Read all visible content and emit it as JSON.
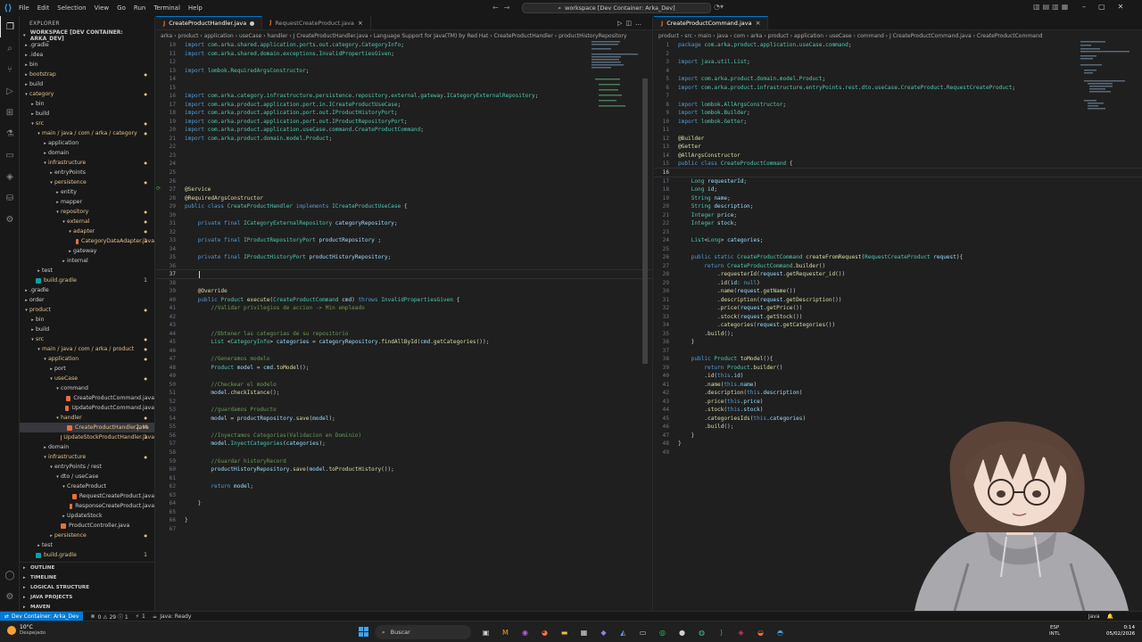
{
  "window": {
    "menu": [
      "File",
      "Edit",
      "Selection",
      "View",
      "Go",
      "Run",
      "Terminal",
      "Help"
    ],
    "search_text": "workspace [Dev Container: Arka_Dev]"
  },
  "activity_icons": [
    "explorer-icon",
    "search-icon",
    "source-control-icon",
    "run-debug-icon",
    "extensions-icon",
    "testing-icon",
    "remote-explorer-icon",
    "docker-icon",
    "database-icon",
    "gear-icon"
  ],
  "sidebar": {
    "title": "EXPLORER",
    "workspace": "WORKSPACE [DEV CONTAINER: ARKA_DEV]",
    "tree": [
      {
        "label": ".gradle",
        "depth": 0,
        "kind": "folder",
        "open": false,
        "color": "#cccccc"
      },
      {
        "label": ".idea",
        "depth": 0,
        "kind": "folder",
        "open": false,
        "color": "#cccccc"
      },
      {
        "label": "bin",
        "depth": 0,
        "kind": "folder",
        "open": false,
        "color": "#cccccc"
      },
      {
        "label": "bootstrap",
        "depth": 0,
        "kind": "folder",
        "open": false,
        "color": "#e2c08d",
        "dot": "#e2c08d"
      },
      {
        "label": "build",
        "depth": 0,
        "kind": "folder",
        "open": false,
        "color": "#cccccc"
      },
      {
        "label": "category",
        "depth": 0,
        "kind": "folder",
        "open": true,
        "color": "#e2c08d",
        "dot": "#e2c08d"
      },
      {
        "label": "bin",
        "depth": 1,
        "kind": "folder",
        "open": false,
        "color": "#cccccc"
      },
      {
        "label": "build",
        "depth": 1,
        "kind": "folder",
        "open": false,
        "color": "#cccccc"
      },
      {
        "label": "src",
        "depth": 1,
        "kind": "folder",
        "open": true,
        "color": "#e2c08d",
        "dot": "#e2c08d"
      },
      {
        "label": "main / java / com / arka / category",
        "depth": 2,
        "kind": "folder",
        "open": true,
        "color": "#e2c08d",
        "dot": "#e2c08d"
      },
      {
        "label": "application",
        "depth": 3,
        "kind": "folder",
        "open": false,
        "color": "#cccccc"
      },
      {
        "label": "domain",
        "depth": 3,
        "kind": "folder",
        "open": false,
        "color": "#cccccc"
      },
      {
        "label": "infrastructure",
        "depth": 3,
        "kind": "folder",
        "open": true,
        "color": "#e2c08d",
        "dot": "#e2c08d"
      },
      {
        "label": "entryPoints",
        "depth": 4,
        "kind": "folder",
        "open": false,
        "color": "#cccccc"
      },
      {
        "label": "persistence",
        "depth": 4,
        "kind": "folder",
        "open": true,
        "color": "#e2c08d",
        "dot": "#e2c08d"
      },
      {
        "label": "entity",
        "depth": 5,
        "kind": "folder",
        "open": false,
        "color": "#cccccc"
      },
      {
        "label": "mapper",
        "depth": 5,
        "kind": "folder",
        "open": false,
        "color": "#cccccc"
      },
      {
        "label": "repository",
        "depth": 5,
        "kind": "folder",
        "open": true,
        "color": "#e2c08d",
        "dot": "#e2c08d"
      },
      {
        "label": "external",
        "depth": 6,
        "kind": "folder",
        "open": true,
        "color": "#e2c08d",
        "dot": "#e2c08d"
      },
      {
        "label": "adapter",
        "depth": 7,
        "kind": "folder",
        "open": true,
        "color": "#e2c08d",
        "dot": "#e2c08d"
      },
      {
        "label": "CategoryDataAdapter.java",
        "depth": 8,
        "kind": "java",
        "color": "#e2c08d",
        "badge": "1"
      },
      {
        "label": "gateway",
        "depth": 7,
        "kind": "folder",
        "open": false,
        "color": "#cccccc"
      },
      {
        "label": "internal",
        "depth": 6,
        "kind": "folder",
        "open": false,
        "color": "#cccccc"
      },
      {
        "label": "test",
        "depth": 2,
        "kind": "folder",
        "open": false,
        "color": "#cccccc"
      },
      {
        "label": "build.gradle",
        "depth": 1,
        "kind": "gradle",
        "color": "#e2c08d",
        "badge": "1"
      },
      {
        "label": ".gradle",
        "depth": 0,
        "kind": "folder",
        "open": false,
        "color": "#cccccc"
      },
      {
        "label": "order",
        "depth": 0,
        "kind": "folder",
        "open": false,
        "color": "#cccccc"
      },
      {
        "label": "product",
        "depth": 0,
        "kind": "folder",
        "open": true,
        "color": "#e2c08d",
        "dot": "#e2c08d"
      },
      {
        "label": "bin",
        "depth": 1,
        "kind": "folder",
        "open": false,
        "color": "#cccccc"
      },
      {
        "label": "build",
        "depth": 1,
        "kind": "folder",
        "open": false,
        "color": "#cccccc"
      },
      {
        "label": "src",
        "depth": 1,
        "kind": "folder",
        "open": true,
        "color": "#e2c08d",
        "dot": "#e2c08d"
      },
      {
        "label": "main / java / com / arka / product",
        "depth": 2,
        "kind": "folder",
        "open": true,
        "color": "#e2c08d",
        "dot": "#e2c08d"
      },
      {
        "label": "application",
        "depth": 3,
        "kind": "folder",
        "open": true,
        "color": "#e2c08d",
        "dot": "#e2c08d"
      },
      {
        "label": "port",
        "depth": 4,
        "kind": "folder",
        "open": false,
        "color": "#cccccc"
      },
      {
        "label": "useCase",
        "depth": 4,
        "kind": "folder",
        "open": true,
        "color": "#e2c08d",
        "dot": "#e2c08d"
      },
      {
        "label": "command",
        "depth": 5,
        "kind": "folder",
        "open": true,
        "color": "#cccccc"
      },
      {
        "label": "CreateProductCommand.java",
        "depth": 6,
        "kind": "java",
        "color": "#cccccc"
      },
      {
        "label": "UpdateProductCommand.java",
        "depth": 6,
        "kind": "java",
        "color": "#cccccc"
      },
      {
        "label": "handler",
        "depth": 5,
        "kind": "folder",
        "open": true,
        "color": "#e2c08d",
        "dot": "#e2c08d"
      },
      {
        "label": "CreateProductHandler.java",
        "depth": 6,
        "kind": "java",
        "color": "#e2c08d",
        "badge": "2, M",
        "selected": true
      },
      {
        "label": "UpdateStockProductHandler.java",
        "depth": 6,
        "kind": "java",
        "color": "#e2c08d",
        "badge": "1"
      },
      {
        "label": "domain",
        "depth": 3,
        "kind": "folder",
        "open": false,
        "color": "#cccccc"
      },
      {
        "label": "infrastructure",
        "depth": 3,
        "kind": "folder",
        "open": true,
        "color": "#e2c08d",
        "dot": "#e2c08d"
      },
      {
        "label": "entryPoints / rest",
        "depth": 4,
        "kind": "folder",
        "open": true,
        "color": "#cccccc"
      },
      {
        "label": "dto / useCase",
        "depth": 5,
        "kind": "folder",
        "open": true,
        "color": "#cccccc"
      },
      {
        "label": "CreateProduct",
        "depth": 6,
        "kind": "folder",
        "open": true,
        "color": "#cccccc"
      },
      {
        "label": "RequestCreateProduct.java",
        "depth": 7,
        "kind": "java",
        "color": "#cccccc"
      },
      {
        "label": "ResponseCreateProduct.java",
        "depth": 7,
        "kind": "java",
        "color": "#cccccc"
      },
      {
        "label": "UpdateStock",
        "depth": 6,
        "kind": "folder",
        "open": false,
        "color": "#cccccc"
      },
      {
        "label": "ProductController.java",
        "depth": 5,
        "kind": "java",
        "color": "#cccccc"
      },
      {
        "label": "persistence",
        "depth": 4,
        "kind": "folder",
        "open": false,
        "color": "#e2c08d",
        "dot": "#e2c08d"
      },
      {
        "label": "test",
        "depth": 2,
        "kind": "folder",
        "open": false,
        "color": "#cccccc"
      },
      {
        "label": "build.gradle",
        "depth": 1,
        "kind": "gradle",
        "color": "#e2c08d",
        "badge": "1"
      }
    ],
    "sections": [
      "OUTLINE",
      "TIMELINE",
      "LOGICAL STRUCTURE",
      "JAVA PROJECTS",
      "MAVEN"
    ]
  },
  "editor_left": {
    "tabs": [
      {
        "label": "CreateProductHandler.java",
        "active": true,
        "dirty": true
      },
      {
        "label": "RequestCreateProduct.java",
        "active": false,
        "dirty": false
      }
    ],
    "breadcrumb": "arka › product › application › useCase › handler › J CreateProductHandler.java › Language Support for Java(TM) by Red Hat › CreateProductHandler › productHistoryRepository",
    "lines": [
      {
        "n": "10",
        "t": "import com.arka.shared.application.ports.out.category.CategoryInfo;"
      },
      {
        "n": "11",
        "t": "import com.arka.shared.domain.exceptions.InvalidPropertiesGiven;"
      },
      {
        "n": "12",
        "t": ""
      },
      {
        "n": "13",
        "t": "import lombok.RequiredArgsConstructor;"
      },
      {
        "n": "14",
        "t": ""
      },
      {
        "n": "15",
        "t": ""
      },
      {
        "n": "16",
        "t": "import com.arka.category.infrastructure.persistence.repository.external.gateway.ICategoryExternalRepository;"
      },
      {
        "n": "17",
        "t": "import com.arka.product.application.port.in.ICreateProductUseCase;"
      },
      {
        "n": "18",
        "t": "import com.arka.product.application.port.out.IProductHistoryPort;"
      },
      {
        "n": "19",
        "t": "import com.arka.product.application.port.out.IProductRepositoryPort;"
      },
      {
        "n": "20",
        "t": "import com.arka.product.application.useCase.command.CreateProductCommand;"
      },
      {
        "n": "21",
        "t": "import com.arka.product.domain.model.Product;"
      },
      {
        "n": "22",
        "t": ""
      },
      {
        "n": "23",
        "t": ""
      },
      {
        "n": "24",
        "t": ""
      },
      {
        "n": "25",
        "t": ""
      },
      {
        "n": "26",
        "t": ""
      },
      {
        "n": "27",
        "t": "@Service"
      },
      {
        "n": "28",
        "t": "@RequiredArgsConstructor"
      },
      {
        "n": "29",
        "t": "public class CreateProductHandler implements ICreateProductUseCase {"
      },
      {
        "n": "30",
        "t": ""
      },
      {
        "n": "31",
        "t": "    private final ICategoryExternalRepository categoryRepository;"
      },
      {
        "n": "32",
        "t": ""
      },
      {
        "n": "33",
        "t": "    private final IProductRepositoryPort productRepository ;"
      },
      {
        "n": "34",
        "t": ""
      },
      {
        "n": "35",
        "t": "    private final IProductHistoryPort productHistoryRepository;"
      },
      {
        "n": "36",
        "t": ""
      },
      {
        "n": "37",
        "t": "    "
      },
      {
        "n": "38",
        "t": ""
      },
      {
        "n": "39",
        "t": "    @Override"
      },
      {
        "n": "40",
        "t": "    public Product execute(CreateProductCommand cmd) throws InvalidPropertiesGiven {"
      },
      {
        "n": "41",
        "t": "        //Validar privilegios de accion -> Min empleado"
      },
      {
        "n": "42",
        "t": ""
      },
      {
        "n": "43",
        "t": ""
      },
      {
        "n": "44",
        "t": "        //Obtener las categorias de su repositorio"
      },
      {
        "n": "45",
        "t": "        List <CategoryInfo> categories = categoryRepository.findAllById(cmd.getCategories());"
      },
      {
        "n": "46",
        "t": ""
      },
      {
        "n": "47",
        "t": "        //Generamos modelo"
      },
      {
        "n": "48",
        "t": "        Product model = cmd.toModel();"
      },
      {
        "n": "49",
        "t": ""
      },
      {
        "n": "50",
        "t": "        //Checkear el modelo"
      },
      {
        "n": "51",
        "t": "        model.checkIstance();"
      },
      {
        "n": "52",
        "t": ""
      },
      {
        "n": "53",
        "t": "        //guardamos Producto"
      },
      {
        "n": "54",
        "t": "        model = productRepository.save(model);"
      },
      {
        "n": "55",
        "t": ""
      },
      {
        "n": "56",
        "t": "        //Inyectamos Categorias(Validacion en Dominio)"
      },
      {
        "n": "57",
        "t": "        model.InyectCategories(categories);"
      },
      {
        "n": "58",
        "t": ""
      },
      {
        "n": "59",
        "t": "        //Guardar historyRecord"
      },
      {
        "n": "60",
        "t": "        productHistoryRepository.save(model.toProductHistory());"
      },
      {
        "n": "61",
        "t": ""
      },
      {
        "n": "62",
        "t": "        return model;"
      },
      {
        "n": "63",
        "t": ""
      },
      {
        "n": "64",
        "t": "    }"
      },
      {
        "n": "65",
        "t": ""
      },
      {
        "n": "66",
        "t": "}"
      },
      {
        "n": "67",
        "t": ""
      }
    ]
  },
  "editor_right": {
    "tabs": [
      {
        "label": "CreateProductCommand.java",
        "active": true,
        "dirty": false
      }
    ],
    "breadcrumb": "product › src › main › java › com › arka › product › application › useCase › command › J CreateProductCommand.java › CreateProductCommand",
    "lines": [
      {
        "n": "1",
        "t": "package com.arka.product.application.useCase.command;"
      },
      {
        "n": "2",
        "t": ""
      },
      {
        "n": "3",
        "t": "import java.util.List;"
      },
      {
        "n": "4",
        "t": ""
      },
      {
        "n": "5",
        "t": "import com.arka.product.domain.model.Product;"
      },
      {
        "n": "6",
        "t": "import com.arka.product.infrastructure.entryPoints.rest.dto.useCase.CreateProduct.RequestCreateProduct;"
      },
      {
        "n": "7",
        "t": ""
      },
      {
        "n": "8",
        "t": "import lombok.AllArgsConstructor;"
      },
      {
        "n": "9",
        "t": "import lombok.Builder;"
      },
      {
        "n": "10",
        "t": "import lombok.Getter;"
      },
      {
        "n": "11",
        "t": ""
      },
      {
        "n": "12",
        "t": "@Builder"
      },
      {
        "n": "13",
        "t": "@Getter"
      },
      {
        "n": "14",
        "t": "@AllArgsConstructor"
      },
      {
        "n": "15",
        "t": "public class CreateProductCommand {"
      },
      {
        "n": "16",
        "t": ""
      },
      {
        "n": "17",
        "t": "    Long requesterId;"
      },
      {
        "n": "18",
        "t": "    Long id;"
      },
      {
        "n": "19",
        "t": "    String name;"
      },
      {
        "n": "20",
        "t": "    String description;"
      },
      {
        "n": "21",
        "t": "    Integer price;"
      },
      {
        "n": "22",
        "t": "    Integer stock;"
      },
      {
        "n": "23",
        "t": ""
      },
      {
        "n": "24",
        "t": "    List<Long> categories;"
      },
      {
        "n": "25",
        "t": ""
      },
      {
        "n": "26",
        "t": "    public static CreateProductCommand createFromRequest(RequestCreateProduct request){"
      },
      {
        "n": "27",
        "t": "        return CreateProductCommand.builder()"
      },
      {
        "n": "28",
        "t": "            .requesterId(request.getRequester_id())"
      },
      {
        "n": "29",
        "t": "            .id(id: null)"
      },
      {
        "n": "30",
        "t": "            .name(request.getName())"
      },
      {
        "n": "31",
        "t": "            .description(request.getDescription())"
      },
      {
        "n": "32",
        "t": "            .price(request.getPrice())"
      },
      {
        "n": "33",
        "t": "            .stock(request.getStock())"
      },
      {
        "n": "34",
        "t": "            .categories(request.getCategories())"
      },
      {
        "n": "35",
        "t": "        .build();"
      },
      {
        "n": "36",
        "t": "    }"
      },
      {
        "n": "37",
        "t": ""
      },
      {
        "n": "38",
        "t": "    public Product toModel(){"
      },
      {
        "n": "39",
        "t": "        return Product.builder()"
      },
      {
        "n": "40",
        "t": "        .id(this.id)"
      },
      {
        "n": "41",
        "t": "        .name(this.name)"
      },
      {
        "n": "42",
        "t": "        .description(this.description)"
      },
      {
        "n": "43",
        "t": "        .price(this.price)"
      },
      {
        "n": "44",
        "t": "        .stock(this.stock)"
      },
      {
        "n": "45",
        "t": "        .categoriesIds(this.categories)"
      },
      {
        "n": "46",
        "t": "        .build();"
      },
      {
        "n": "47",
        "t": "    }"
      },
      {
        "n": "48",
        "t": "}"
      },
      {
        "n": "49",
        "t": ""
      }
    ]
  },
  "statusbar": {
    "remote": "Dev Container: Arka_Dev",
    "problems": "0 ⚠ 29 ⓘ 1",
    "ports": "1",
    "java": "Java: Ready",
    "language": "Java"
  },
  "taskbar": {
    "temperature": "10°C",
    "weather": "Despejado",
    "search": "Buscar",
    "lang1": "ESP",
    "lang2": "INTL",
    "time": "0:14",
    "date": "05/02/2026"
  },
  "colors": {
    "keyword": "#569cd6",
    "type": "#4ec9b0",
    "string": "#ce9178",
    "comment": "#6a9955",
    "annotation": "#dcdcaa",
    "variable": "#9cdcfe",
    "method": "#dcdcaa",
    "accent": "#0078d4",
    "modified": "#e2c08d"
  }
}
